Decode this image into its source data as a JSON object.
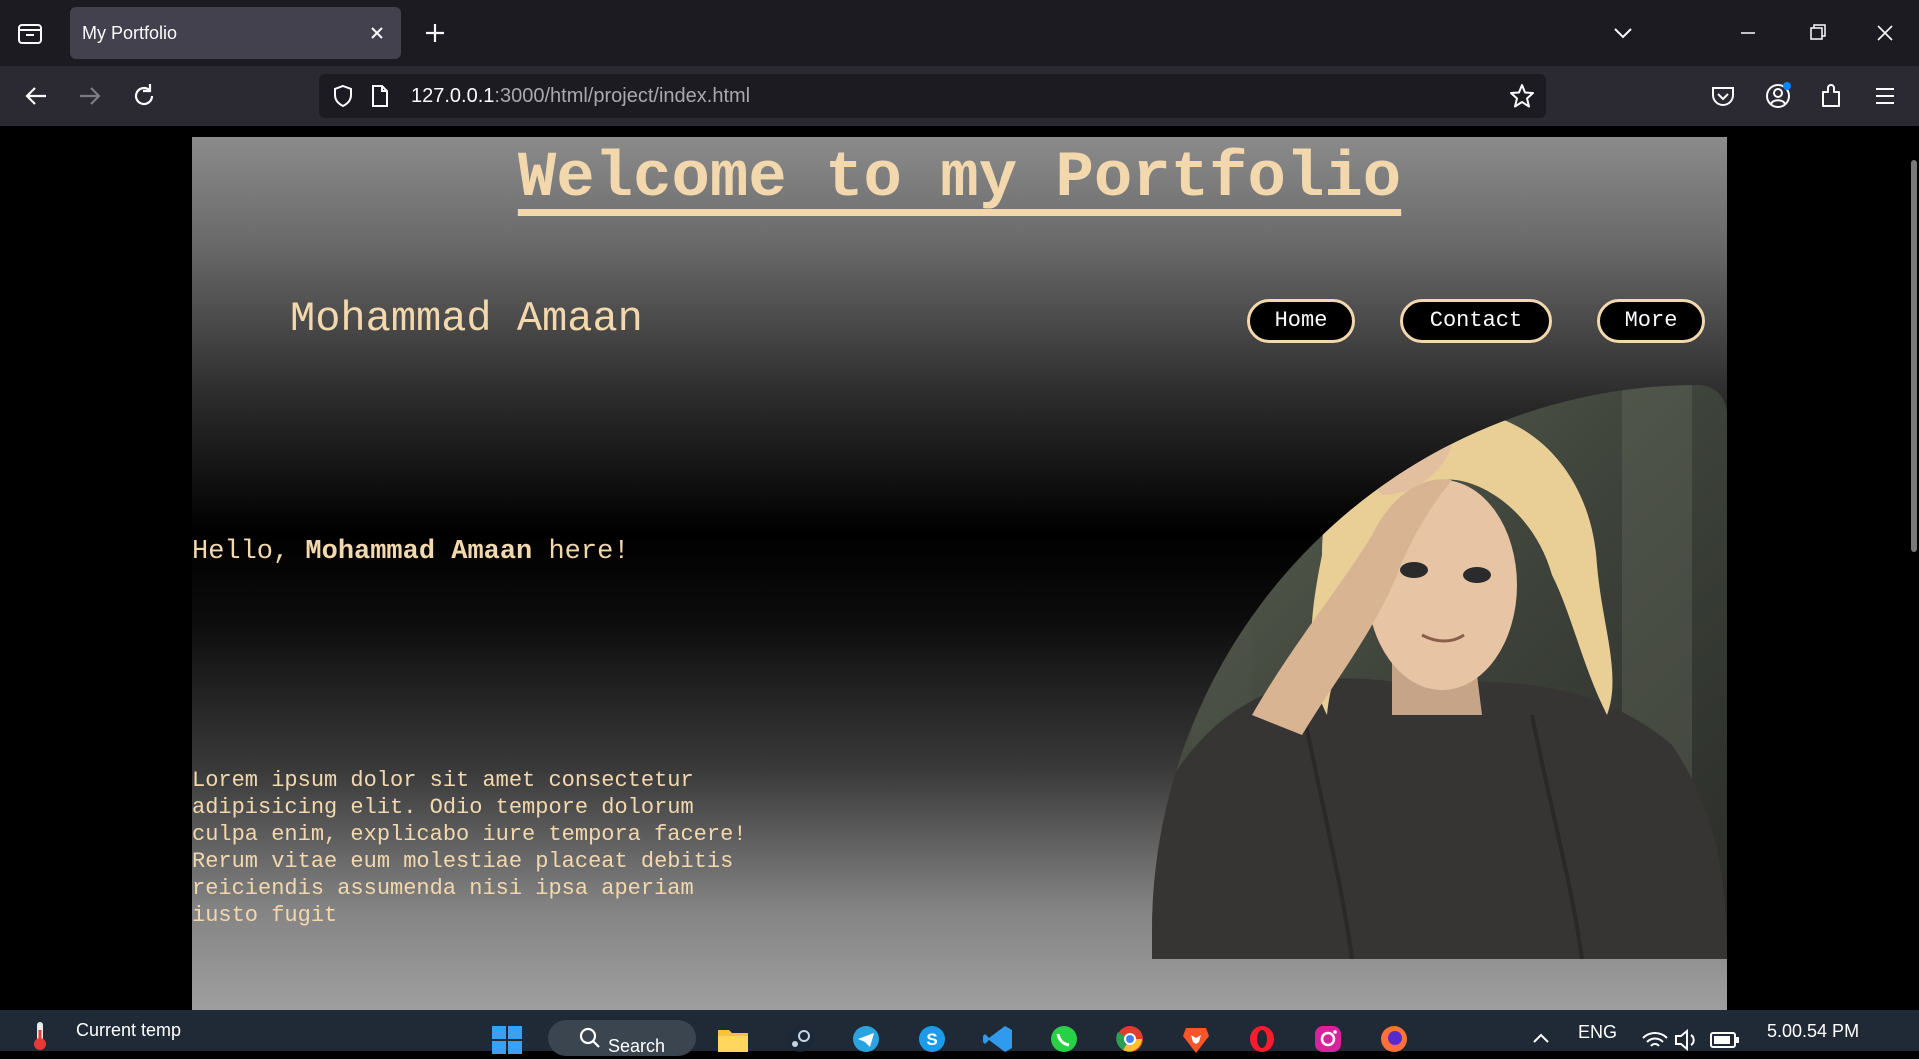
{
  "browser": {
    "tab_title": "My Portfolio",
    "url_host": "127.0.0.1",
    "url_rest": ":3000/html/project/index.html"
  },
  "page": {
    "headline": "Welcome to my Portfolio",
    "brand": "Mohammad Amaan",
    "nav": [
      "Home",
      "Contact",
      "More"
    ],
    "hello_prefix": "Hello, ",
    "hello_name": "Mohammad Amaan",
    "hello_suffix": " here!",
    "lorem": "Lorem ipsum dolor sit amet consectetur adipisicing elit. Odio tempore dolorum culpa enim, explicabo iure tempora facere! Rerum vitae eum molestiae placeat debitis reiciendis assumenda nisi ipsa aperiam iusto fugit"
  },
  "taskbar": {
    "weather_label": "Current temp",
    "search_label": "Search",
    "language": "ENG",
    "time": "5.00.54 PM"
  },
  "colors": {
    "accent_text": "#f3d8ad",
    "chrome_dark": "#1c1b22",
    "taskbar": "#1f2a36"
  },
  "icons": [
    "tab-list-icon",
    "close-icon",
    "plus-icon",
    "chevron-down-icon",
    "minimize-icon",
    "restore-icon",
    "back-icon",
    "forward-icon",
    "reload-icon",
    "shield-icon",
    "page-icon",
    "star-icon",
    "pocket-icon",
    "account-icon",
    "extensions-icon",
    "menu-icon",
    "thermometer-icon",
    "windows-start-icon",
    "search-icon",
    "file-explorer-icon",
    "steam-icon",
    "telegram-icon",
    "skype-icon",
    "vscode-icon",
    "whatsapp-icon",
    "chrome-icon",
    "brave-icon",
    "opera-icon",
    "instagram-icon",
    "firefox-icon",
    "chevron-up-icon",
    "wifi-icon",
    "volume-icon",
    "battery-icon"
  ]
}
